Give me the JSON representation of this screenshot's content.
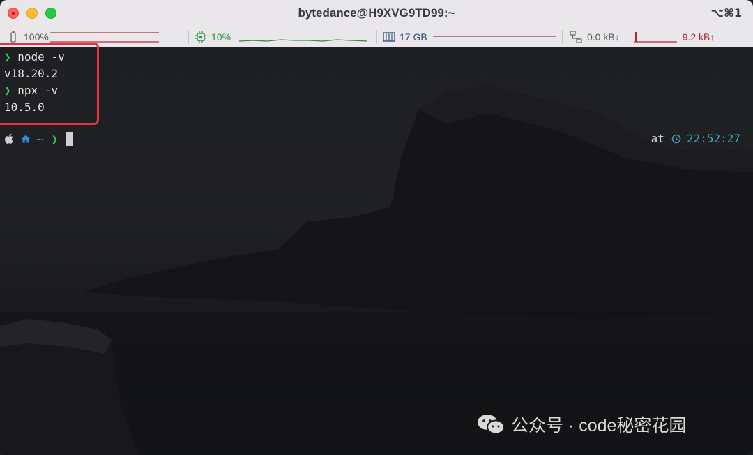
{
  "window": {
    "title": "bytedance@H9XVG9TD99:~",
    "shortcut": "⌥⌘1"
  },
  "status": {
    "battery": "100%",
    "cpu": "10%",
    "memory": "17 GB",
    "net_down": "0.0 kB↓",
    "net_up": "9.2 kB↑"
  },
  "terminal": {
    "lines": [
      {
        "prompt": "❯",
        "command": "node -v"
      },
      {
        "output": "v18.20.2"
      },
      {
        "prompt": "❯",
        "command": "npx -v"
      },
      {
        "output": "10.5.0"
      }
    ],
    "prompt_home": "~",
    "prompt_arrow": "❯",
    "right_prefix": "at",
    "right_time": "22:52:27"
  },
  "watermark": {
    "text": "公众号 · code秘密花园"
  },
  "colors": {
    "prompt_green": "#2fcf5b",
    "time_cyan": "#3aa6b9",
    "highlight_red": "#e3343f",
    "net_up_red": "#b0243a"
  }
}
